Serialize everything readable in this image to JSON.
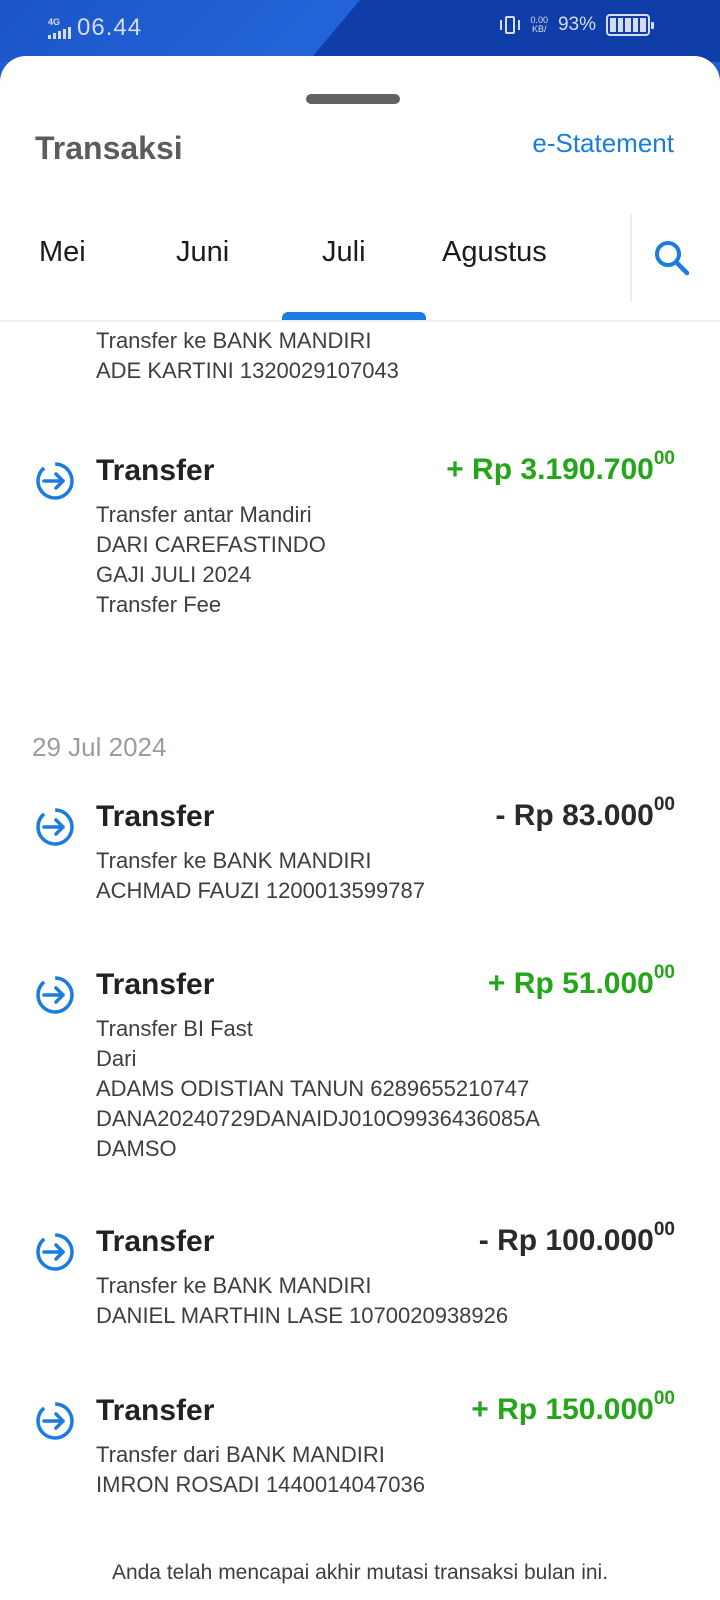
{
  "status": {
    "time": "06.44",
    "network": "4G",
    "speed_value": "0.00",
    "speed_unit": "KB/",
    "battery": "93%"
  },
  "header": {
    "title": "Transaksi",
    "estatement_label": "e-Statement"
  },
  "tabs": [
    {
      "label": "Mei"
    },
    {
      "label": "Juni"
    },
    {
      "label": "Juli"
    },
    {
      "label": "Agustus"
    }
  ],
  "active_tab": "Juli",
  "top_partial": {
    "lines": [
      "Transfer ke BANK MANDIRI",
      "ADE KARTINI 1320029107043"
    ]
  },
  "transactions_top": [
    {
      "name": "Transfer",
      "amount": "+ Rp 3.190.700",
      "cents": "00",
      "direction": "in",
      "lines": [
        "Transfer antar Mandiri",
        "DARI CAREFASTINDO",
        "GAJI JULI 2024",
        "Transfer Fee"
      ]
    }
  ],
  "date_group": "29 Jul 2024",
  "transactions": [
    {
      "name": "Transfer",
      "amount": "- Rp 83.000",
      "cents": "00",
      "direction": "out",
      "lines": [
        "Transfer ke BANK MANDIRI",
        "ACHMAD FAUZI 1200013599787"
      ]
    },
    {
      "name": "Transfer",
      "amount": "+ Rp 51.000",
      "cents": "00",
      "direction": "in",
      "lines": [
        "Transfer BI Fast",
        "Dari",
        "ADAMS ODISTIAN TANUN 6289655210747",
        "DANA20240729DANAIDJ010O9936436085A",
        "DAMSO"
      ]
    },
    {
      "name": "Transfer",
      "amount": "- Rp 100.000",
      "cents": "00",
      "direction": "out",
      "lines": [
        "Transfer ke BANK MANDIRI",
        "DANIEL MARTHIN LASE 1070020938926"
      ]
    },
    {
      "name": "Transfer",
      "amount": "+ Rp 150.000",
      "cents": "00",
      "direction": "in",
      "lines": [
        "Transfer dari BANK MANDIRI",
        "IMRON ROSADI 1440014047036"
      ]
    }
  ],
  "footer": "Anda telah mencapai akhir mutasi transaksi bulan ini.",
  "colors": {
    "accent": "#1a7be0",
    "income": "#25a519",
    "expense": "#2a2a2a"
  }
}
